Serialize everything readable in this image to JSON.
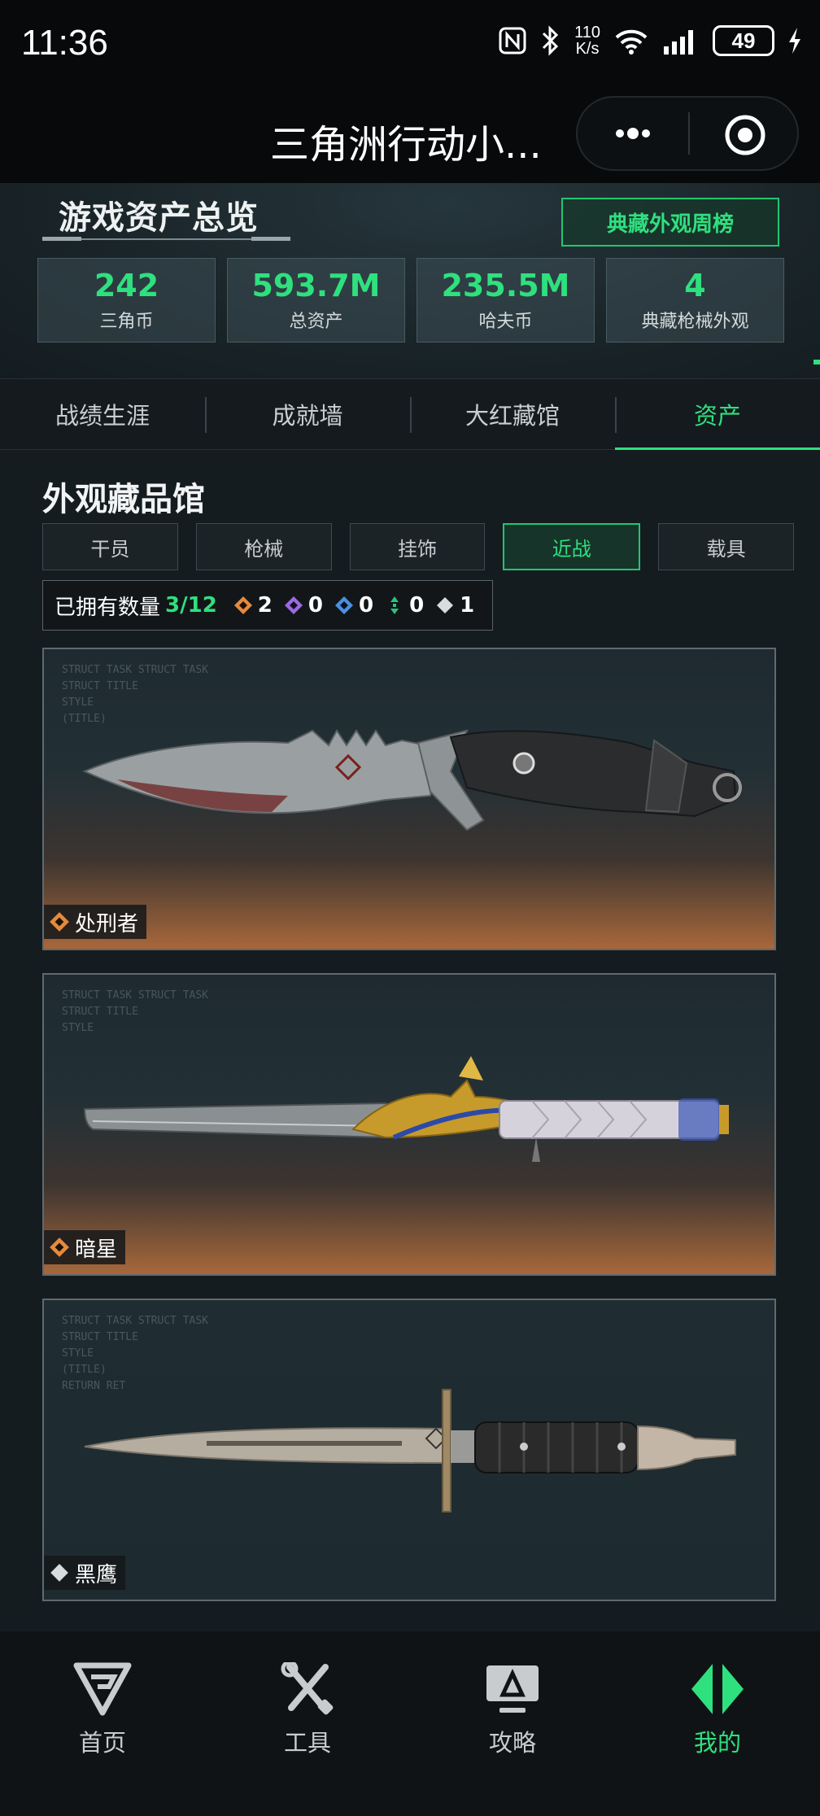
{
  "status_bar": {
    "time": "11:36",
    "net_speed_value": "110",
    "net_speed_unit": "K/s",
    "battery": "49"
  },
  "title_bar": {
    "title": "三角洲行动小..."
  },
  "header": {
    "title": "游戏资产总览",
    "rank_button": "典藏外观周榜",
    "stats": [
      {
        "value": "242",
        "label": "三角币"
      },
      {
        "value": "593.7M",
        "label": "总资产"
      },
      {
        "value": "235.5M",
        "label": "哈夫币"
      },
      {
        "value": "4",
        "label": "典藏枪械外观"
      }
    ]
  },
  "tabs": [
    {
      "label": "战绩生涯",
      "active": false
    },
    {
      "label": "成就墙",
      "active": false
    },
    {
      "label": "大红藏馆",
      "active": false
    },
    {
      "label": "资产",
      "active": true
    }
  ],
  "gallery": {
    "title": "外观藏品馆",
    "categories": [
      {
        "label": "干员",
        "active": false
      },
      {
        "label": "枪械",
        "active": false
      },
      {
        "label": "挂饰",
        "active": false
      },
      {
        "label": "近战",
        "active": true
      },
      {
        "label": "载具",
        "active": false
      }
    ],
    "owned_label": "已拥有数量",
    "owned_value": "3/12",
    "rarity_counts": [
      {
        "icon": "orange-diamond-icon",
        "color": "#e58a3c",
        "count": "2"
      },
      {
        "icon": "purple-diamond-icon",
        "color": "#9b6ae0",
        "count": "0"
      },
      {
        "icon": "blue-diamond-icon",
        "color": "#4d8fe0",
        "count": "0"
      },
      {
        "icon": "green-diamond-icon",
        "color": "#2fc07a",
        "count": "0"
      },
      {
        "icon": "white-diamond-icon",
        "color": "#d8dcdd",
        "count": "1"
      }
    ],
    "items": [
      {
        "name": "处刑者",
        "rarity_icon": "orange-diamond-icon",
        "rarity_color": "#e58a3c"
      },
      {
        "name": "暗星",
        "rarity_icon": "orange-diamond-icon",
        "rarity_color": "#e58a3c"
      },
      {
        "name": "黑鹰",
        "rarity_icon": "white-diamond-icon",
        "rarity_color": "#d8dcdd"
      }
    ]
  },
  "bottom_nav": [
    {
      "label": "首页",
      "icon": "home-logo-icon",
      "active": false
    },
    {
      "label": "工具",
      "icon": "tools-icon",
      "active": false
    },
    {
      "label": "攻略",
      "icon": "guide-monitor-icon",
      "active": false
    },
    {
      "label": "我的",
      "icon": "profile-logo-icon",
      "active": true
    }
  ]
}
